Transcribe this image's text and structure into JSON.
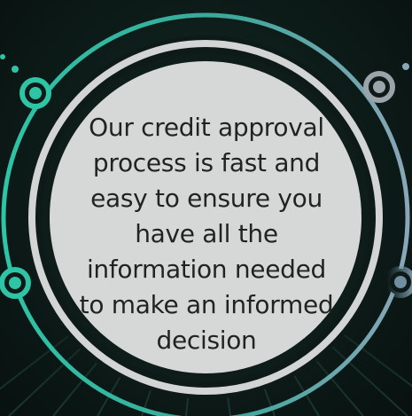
{
  "message": "Our credit approval process is fast and easy to ensure you have all the information needed to make an informed decision",
  "colors": {
    "background": "#0b1613",
    "ring_gradient_start": "#2ec4a6",
    "ring_gradient_end": "#8aa6b8",
    "center_disc": "#d6d8d7",
    "dark_ring": "#0d1a17",
    "text": "#1f2322"
  },
  "icons": [
    "node-top-left-icon",
    "node-left-icon",
    "node-top-right-icon",
    "node-right-icon",
    "accent-dots-icon"
  ]
}
